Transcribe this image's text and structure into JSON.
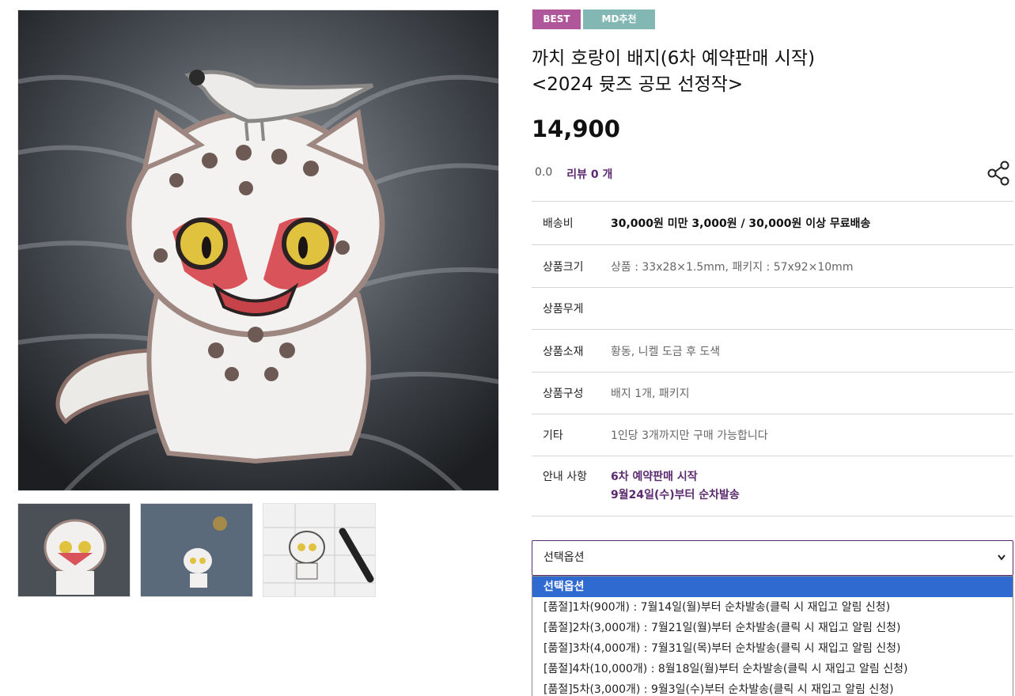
{
  "badges": {
    "best": "BEST",
    "md": "MD추천"
  },
  "product": {
    "title_line1": "까치 호랑이 배지(6차 예약판매 시작)",
    "title_line2": "<2024 뮷즈 공모 선정작>",
    "price": "14,900",
    "rating": "0.0",
    "review_label": "리뷰 0 개"
  },
  "specs": [
    {
      "key": "배송비",
      "value": "30,000원 미만 3,000원 / 30,000원 이상 무료배송"
    },
    {
      "key": "상품크기",
      "value": "상품 : 33x28×1.5mm, 패키지 : 57x92×10mm"
    },
    {
      "key": "상품무게",
      "value": ""
    },
    {
      "key": "상품소재",
      "value": "황동, 니켈 도금 후 도색"
    },
    {
      "key": "상품구성",
      "value": "배지 1개, 패키지"
    },
    {
      "key": "기타",
      "value": "1인당 3개까지만 구매 가능합니다"
    },
    {
      "key": "안내 사항",
      "value_line1": "6차 예약판매 시작",
      "value_line2": "9월24일(수)부터 순차발송"
    }
  ],
  "option_select": {
    "selected": "선택옵션",
    "options": [
      "선택옵션",
      "[품절]1차(900개) : 7월14일(월)부터 순차발송(클릭 시 재입고 알림 신청)",
      "[품절]2차(3,000개) : 7월21일(월)부터 순차발송(클릭 시 재입고 알림 신청)",
      "[품절]3차(4,000개) : 7월31일(목)부터 순차발송(클릭 시 재입고 알림 신청)",
      "[품절]4차(10,000개) : 8월18일(월)부터 순차발송(클릭 시 재입고 알림 신청)",
      "[품절]5차(3,000개) : 9월3일(수)부터 순차발송(클릭 시 재입고 알림 신청)"
    ]
  },
  "colors": {
    "best_badge": "#b0579c",
    "md_badge": "#82b7b4",
    "accent_purple": "#5b2a6e",
    "dropdown_highlight": "#2f6ad0"
  },
  "icons": {
    "share": "share-icon",
    "chevron": "chevron-down-icon"
  }
}
